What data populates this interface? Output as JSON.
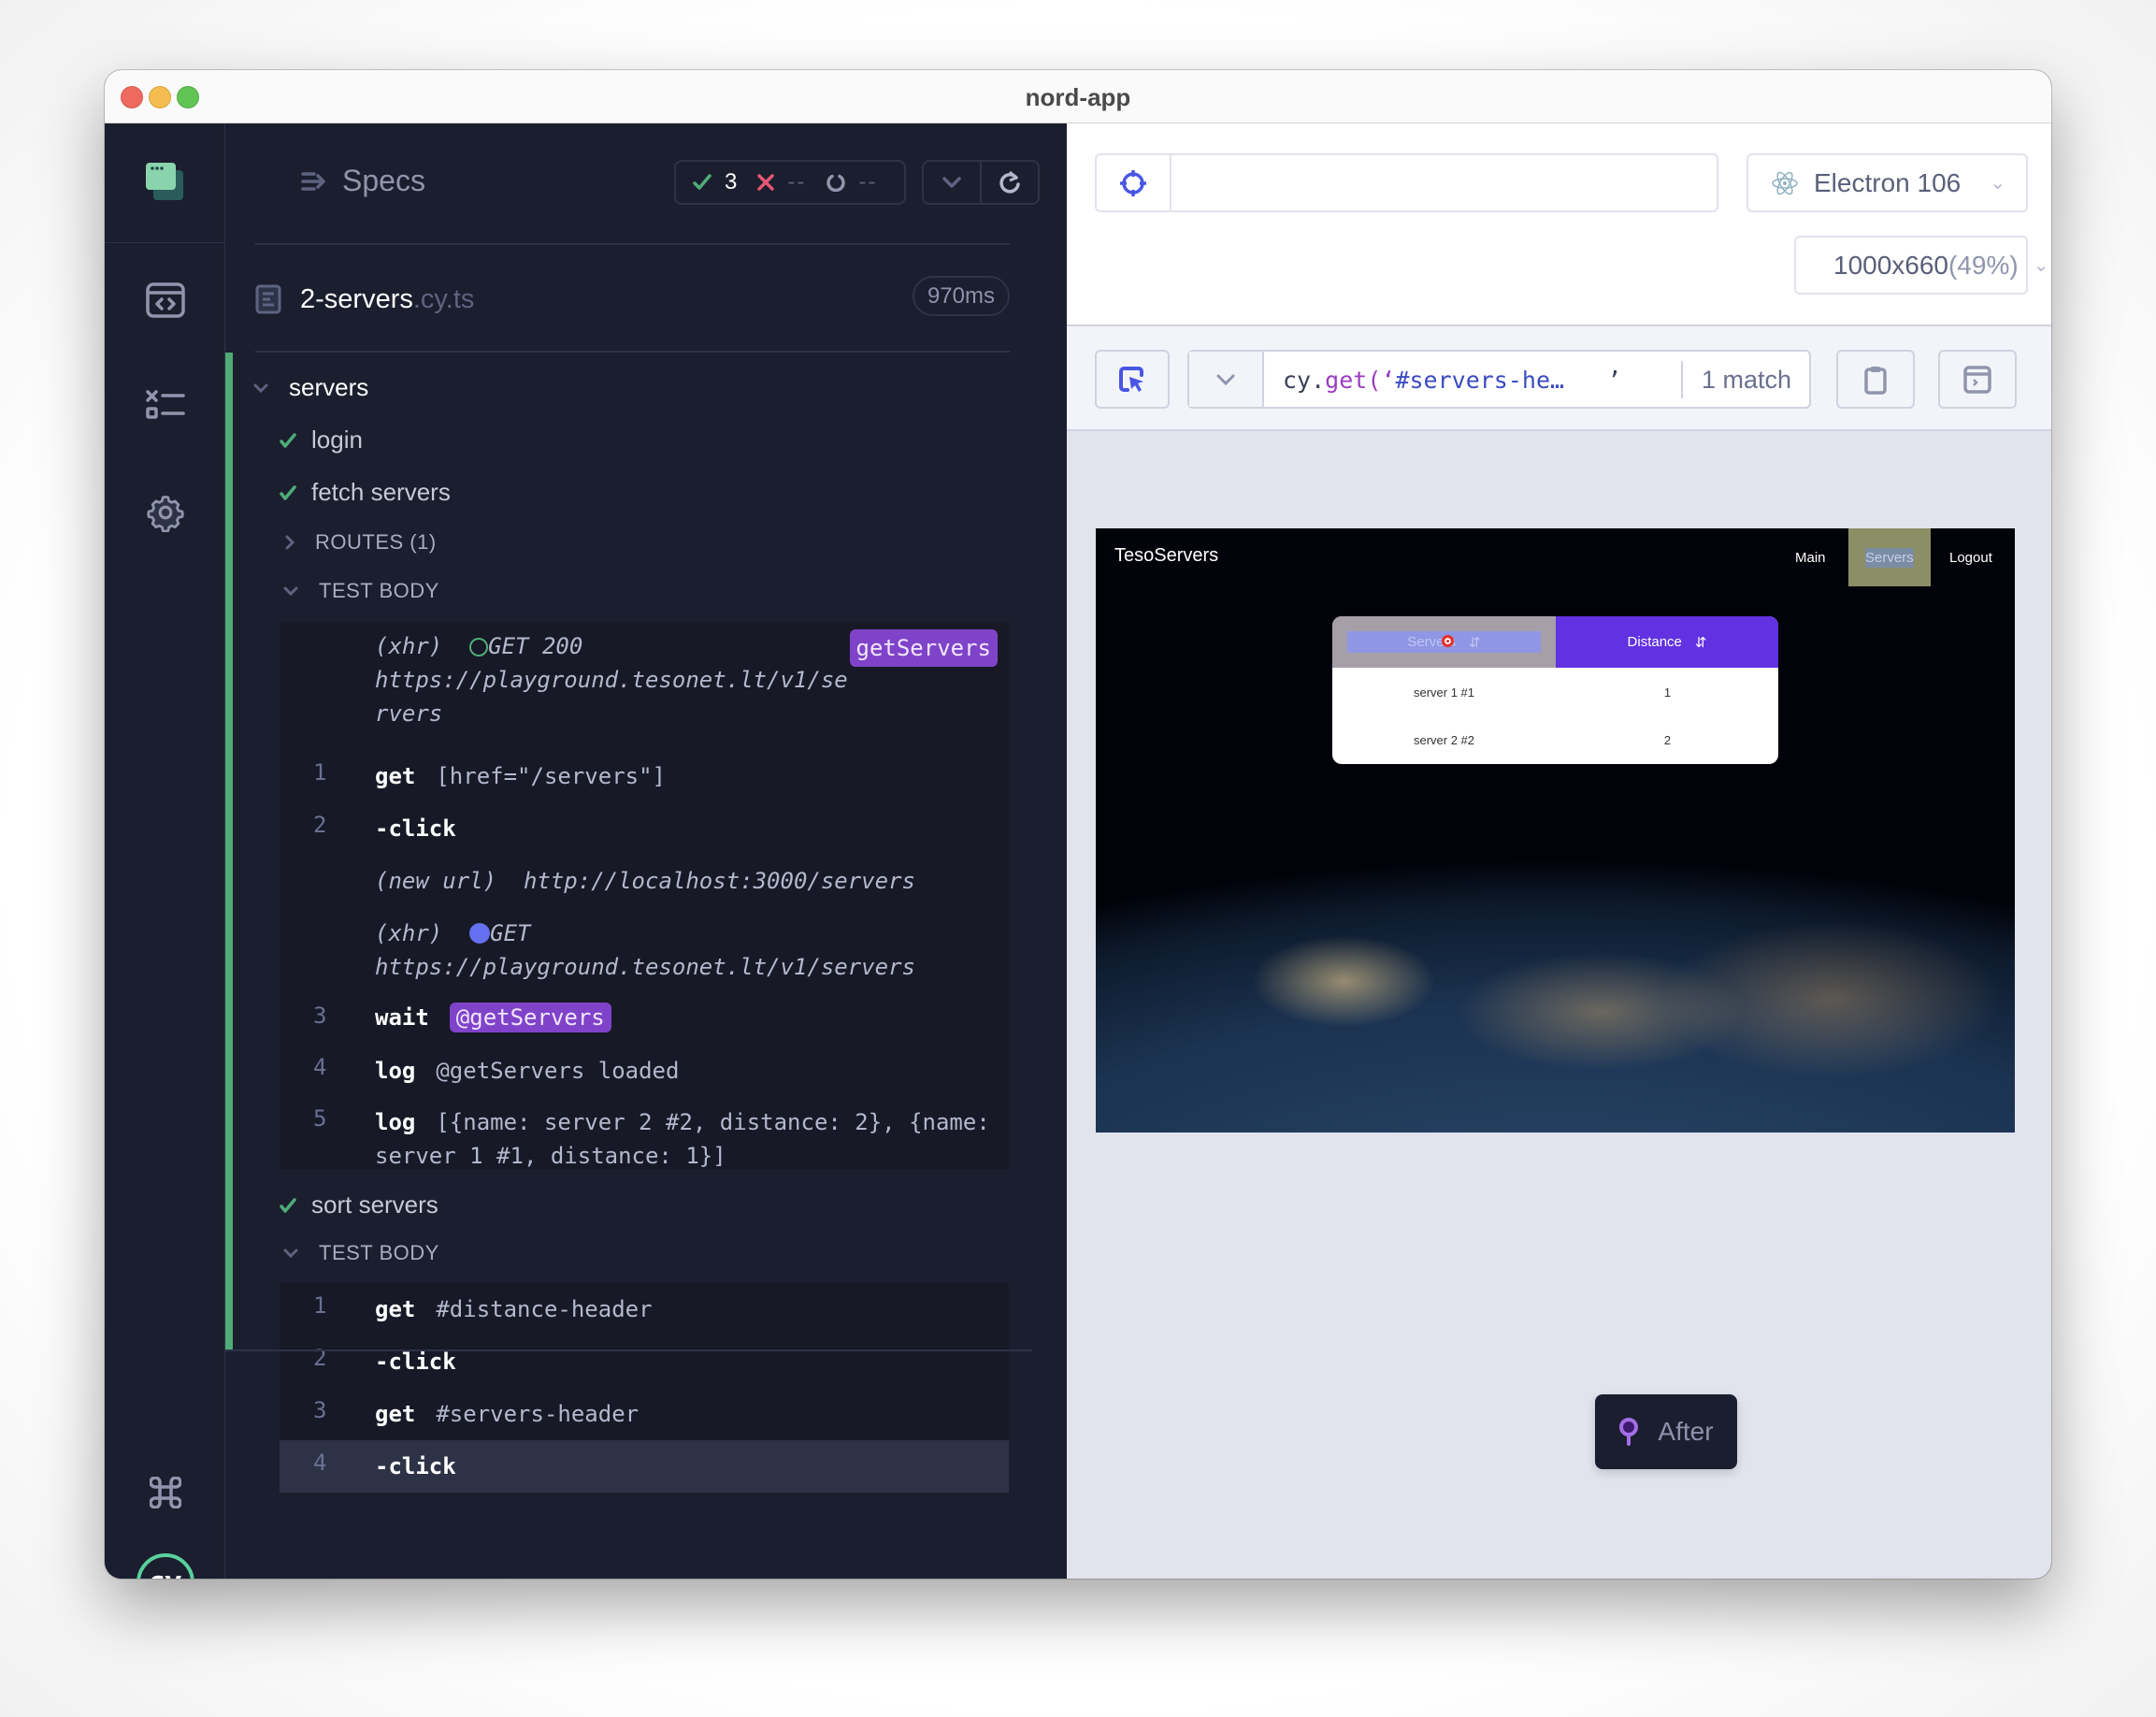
{
  "window": {
    "title": "nord-app"
  },
  "sidebar": {
    "items": [
      {
        "name": "app-logo",
        "icon": "cypress-app-icon"
      },
      {
        "name": "specs",
        "icon": "browser-code-icon"
      },
      {
        "name": "runs",
        "icon": "test-list-icon"
      },
      {
        "name": "settings",
        "icon": "gear-icon"
      },
      {
        "name": "shortcuts",
        "icon": "command-key-icon"
      },
      {
        "name": "cypress",
        "icon": "cypress-logo",
        "label": "cy"
      }
    ]
  },
  "reporter": {
    "specs_label": "Specs",
    "stats": {
      "passed": "3",
      "failed": "--",
      "pending": "--"
    },
    "file": {
      "name": "2-servers",
      "ext": ".cy.ts",
      "duration": "970ms"
    },
    "suite": {
      "title": "servers",
      "tests": [
        {
          "title": "login",
          "state": "passed"
        },
        {
          "title": "fetch servers",
          "state": "passed"
        },
        {
          "title": "sort servers",
          "state": "passed"
        }
      ],
      "fetch_sections": {
        "routes": "ROUTES (1)",
        "body": "TEST BODY"
      },
      "fetch_commands": [
        {
          "type": "xhr",
          "prefix": "(xhr)",
          "method": "GET 200",
          "url_line1": "https://playground.tesonet.lt/v1/se",
          "url_line2": "rvers",
          "alias": "getServers"
        },
        {
          "num": "1",
          "name": "get",
          "message": "[href=\"/servers\"]"
        },
        {
          "num": "2",
          "name": "-click",
          "message": ""
        },
        {
          "type": "new-url",
          "prefix": "(new url)",
          "url": "http://localhost:3000/servers"
        },
        {
          "type": "xhr",
          "prefix": "(xhr)",
          "method": "GET",
          "url": "https://playground.tesonet.lt/v1/servers"
        },
        {
          "num": "3",
          "name": "wait",
          "alias": "@getServers"
        },
        {
          "num": "4",
          "name": "log",
          "message": "@getServers loaded"
        },
        {
          "num": "5",
          "name": "log",
          "message_line1": "[{name: server 2 #2, distance: 2}, {name:",
          "message_line2": "server 1 #1, distance: 1}]"
        }
      ],
      "sort_sections": {
        "body": "TEST BODY"
      },
      "sort_commands": [
        {
          "num": "1",
          "name": "get",
          "message": "#distance-header"
        },
        {
          "num": "2",
          "name": "-click",
          "message": ""
        },
        {
          "num": "3",
          "name": "get",
          "message": "#servers-header"
        },
        {
          "num": "4",
          "name": "-click",
          "message": "",
          "active": true
        }
      ]
    }
  },
  "preview": {
    "url_value": "",
    "browser": "Electron 106",
    "viewport": "1000x660",
    "viewport_scale": "(49%)",
    "selector": {
      "prefix": "cy",
      "method": "get",
      "open": "(‘",
      "value": "#servers-he…",
      "close": "’",
      "matches": "1 match"
    },
    "aut": {
      "brand": "TesoServers",
      "nav": [
        "Main",
        "Servers",
        "Logout"
      ],
      "active_nav": "Servers",
      "table": {
        "headers": [
          "Servers",
          "Distance"
        ],
        "rows": [
          [
            "server 1 #1",
            "1"
          ],
          [
            "server 2 #2",
            "2"
          ]
        ]
      }
    },
    "snapshot_label": "After"
  },
  "colors": {
    "passed": "#4fac77",
    "failed": "#e45770",
    "alias": "#7f43c9",
    "accent": "#4956e3",
    "distance_header": "#6131e2"
  }
}
